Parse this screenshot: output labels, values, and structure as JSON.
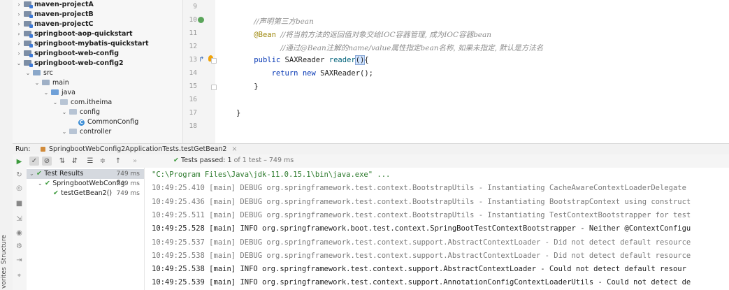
{
  "project_tree": [
    {
      "label": "maven-projectA",
      "indent": 0,
      "arrow": "›",
      "icon": "module",
      "bold": true
    },
    {
      "label": "maven-projectB",
      "indent": 0,
      "arrow": "›",
      "icon": "module",
      "bold": true
    },
    {
      "label": "maven-projectC",
      "indent": 0,
      "arrow": "›",
      "icon": "module",
      "bold": true
    },
    {
      "label": "springboot-aop-quickstart",
      "indent": 0,
      "arrow": "›",
      "icon": "module",
      "bold": true
    },
    {
      "label": "springboot-mybatis-quickstart",
      "indent": 0,
      "arrow": "›",
      "icon": "module",
      "bold": true
    },
    {
      "label": "springboot-web-config",
      "indent": 0,
      "arrow": "›",
      "icon": "module",
      "bold": true
    },
    {
      "label": "springboot-web-config2",
      "indent": 0,
      "arrow": "⌄",
      "icon": "module",
      "bold": true
    },
    {
      "label": "src",
      "indent": 1,
      "arrow": "⌄",
      "icon": "src",
      "bold": false
    },
    {
      "label": "main",
      "indent": 2,
      "arrow": "⌄",
      "icon": "folder",
      "bold": false
    },
    {
      "label": "java",
      "indent": 3,
      "arrow": "⌄",
      "icon": "java",
      "bold": false
    },
    {
      "label": "com.itheima",
      "indent": 4,
      "arrow": "⌄",
      "icon": "package",
      "bold": false
    },
    {
      "label": "config",
      "indent": 5,
      "arrow": "⌄",
      "icon": "package",
      "bold": false
    },
    {
      "label": "CommonConfig",
      "indent": 6,
      "arrow": "",
      "icon": "class",
      "bold": false
    },
    {
      "label": "controller",
      "indent": 5,
      "arrow": "⌄",
      "icon": "package",
      "bold": false
    }
  ],
  "editor": {
    "line_numbers": [
      "9",
      "10",
      "11",
      "12",
      "13",
      "14",
      "15",
      "16",
      "17",
      "18"
    ],
    "lines": [
      {
        "segments": []
      },
      {
        "segments": [
          {
            "text": "    ",
            "cls": ""
          },
          {
            "text": "//声明第三方bean",
            "cls": "cmt"
          }
        ]
      },
      {
        "segments": [
          {
            "text": "    ",
            "cls": ""
          },
          {
            "text": "@Bean",
            "cls": "ann"
          },
          {
            "text": " ",
            "cls": ""
          },
          {
            "text": "//将当前方法的返回值对象交给IOC容器管理, 成为IOC容器bean",
            "cls": "cmt"
          }
        ]
      },
      {
        "segments": [
          {
            "text": "          ",
            "cls": ""
          },
          {
            "text": "//通过@Bean注解的name/value属性指定bean名称, 如果未指定, 默认是方法名",
            "cls": "cmt"
          }
        ]
      },
      {
        "segments": [
          {
            "text": "    ",
            "cls": ""
          },
          {
            "text": "public",
            "cls": "kw"
          },
          {
            "text": " SAXReader ",
            "cls": ""
          },
          {
            "text": "reader",
            "cls": "mth"
          },
          {
            "text": "()",
            "cls": "caret"
          },
          {
            "text": "{",
            "cls": ""
          }
        ]
      },
      {
        "segments": [
          {
            "text": "        ",
            "cls": ""
          },
          {
            "text": "return",
            "cls": "kw"
          },
          {
            "text": " ",
            "cls": ""
          },
          {
            "text": "new",
            "cls": "kw"
          },
          {
            "text": " SAXReader();",
            "cls": ""
          }
        ]
      },
      {
        "segments": [
          {
            "text": "    }",
            "cls": ""
          }
        ]
      },
      {
        "segments": []
      },
      {
        "segments": [
          {
            "text": "}",
            "cls": ""
          }
        ]
      },
      {
        "segments": []
      }
    ]
  },
  "run_bar": {
    "label": "Run:",
    "tab": "SpringbootWebConfig2ApplicationTests.testGetBean2",
    "close": "×"
  },
  "run_toolbar": {
    "status_main": "Tests passed: ",
    "status_count": "1",
    "status_sub": " of 1 test – 749 ms"
  },
  "test_tree": [
    {
      "label": "Test Results",
      "time": "749 ms",
      "indent": 0,
      "selected": true
    },
    {
      "label": "SpringbootWebConfig.",
      "time": "749 ms",
      "indent": 1,
      "selected": false
    },
    {
      "label": "testGetBean2()",
      "time": "749 ms",
      "indent": 2,
      "selected": false
    }
  ],
  "console_lines": [
    {
      "text": "\"C:\\Program Files\\Java\\jdk-11.0.15.1\\bin\\java.exe\" ...",
      "level": "cmd"
    },
    {
      "text": "10:49:25.410 [main] DEBUG org.springframework.test.context.BootstrapUtils - Instantiating CacheAwareContextLoaderDelegate",
      "level": "debug"
    },
    {
      "text": "10:49:25.436 [main] DEBUG org.springframework.test.context.BootstrapUtils - Instantiating BootstrapContext using construct",
      "level": "debug"
    },
    {
      "text": "10:49:25.511 [main] DEBUG org.springframework.test.context.BootstrapUtils - Instantiating TestContextBootstrapper for test",
      "level": "debug"
    },
    {
      "text": "10:49:25.528 [main] INFO org.springframework.boot.test.context.SpringBootTestContextBootstrapper - Neither @ContextConfigu",
      "level": "info"
    },
    {
      "text": "10:49:25.537 [main] DEBUG org.springframework.test.context.support.AbstractContextLoader - Did not detect default resource",
      "level": "debug"
    },
    {
      "text": "10:49:25.538 [main] DEBUG org.springframework.test.context.support.AbstractContextLoader - Did not detect default resource",
      "level": "debug"
    },
    {
      "text": "10:49:25.538 [main] INFO org.springframework.test.context.support.AbstractContextLoader - Could not detect default resour",
      "level": "info"
    },
    {
      "text": "10:49:25.539 [main] INFO org.springframework.test.context.support.AnnotationConfigContextLoaderUtils - Could not detect de",
      "level": "info"
    }
  ],
  "side_labels": {
    "structure": "Structure",
    "favorites": "vorites"
  }
}
